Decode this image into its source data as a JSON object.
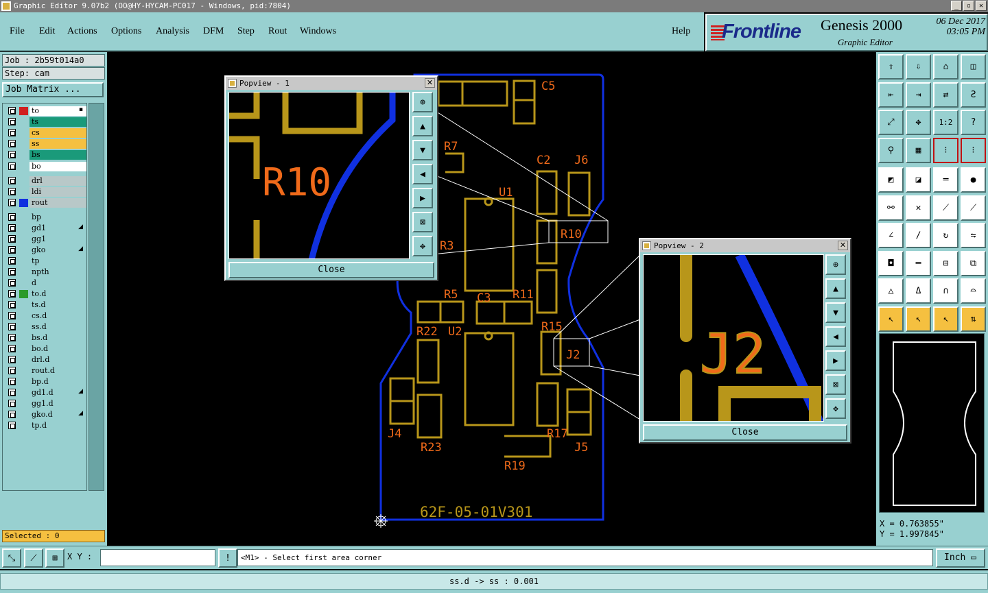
{
  "window": {
    "title": "Graphic Editor 9.07b2 (OO@HY-HYCAM-PC017 - Windows, pid:7804)",
    "min": "_",
    "max": "▫",
    "close": "✕"
  },
  "menu": {
    "file": "File",
    "edit": "Edit",
    "actions": "Actions",
    "options": "Options",
    "analysis": "Analysis",
    "dfm": "DFM",
    "step": "Step",
    "rout": "Rout",
    "windows": "Windows",
    "help": "Help"
  },
  "brand": {
    "logo": "Frontline",
    "product": "Genesis 2000",
    "subtitle": "Graphic Editor",
    "date": "06 Dec 2017",
    "time": "03:05 PM"
  },
  "job": {
    "job_line": "Job : 2b59t014a0",
    "step_line": "Step: cam",
    "matrix_button": "Job Matrix ..."
  },
  "layers": [
    {
      "name": "to",
      "bg": "#ffffff",
      "swatch": "#d02020",
      "mark": "▪"
    },
    {
      "name": "ts",
      "bg": "#1a9a7a",
      "swatch": "",
      "mark": ""
    },
    {
      "name": "cs",
      "bg": "#f5c040",
      "swatch": "",
      "mark": ""
    },
    {
      "name": "ss",
      "bg": "#f5c040",
      "swatch": "",
      "mark": ""
    },
    {
      "name": "bs",
      "bg": "#1a9a7a",
      "swatch": "",
      "mark": ""
    },
    {
      "name": "bo",
      "bg": "#ffffff",
      "swatch": "",
      "mark": ""
    },
    {
      "name": "drl",
      "bg": "#b8c8c8",
      "swatch": "",
      "mark": ""
    },
    {
      "name": "ldi",
      "bg": "#b8c8c8",
      "swatch": "",
      "mark": ""
    },
    {
      "name": "rout",
      "bg": "#b8c8c8",
      "swatch": "#1030e0",
      "mark": ""
    },
    {
      "name": "bp",
      "bg": "#98d0d0",
      "swatch": "",
      "mark": ""
    },
    {
      "name": "gd1",
      "bg": "#98d0d0",
      "swatch": "",
      "mark": "◢"
    },
    {
      "name": "gg1",
      "bg": "#98d0d0",
      "swatch": "",
      "mark": ""
    },
    {
      "name": "gko",
      "bg": "#98d0d0",
      "swatch": "",
      "mark": "◢"
    },
    {
      "name": "tp",
      "bg": "#98d0d0",
      "swatch": "",
      "mark": ""
    },
    {
      "name": "npth",
      "bg": "#98d0d0",
      "swatch": "",
      "mark": ""
    },
    {
      "name": "d",
      "bg": "#98d0d0",
      "swatch": "",
      "mark": ""
    },
    {
      "name": "to.d",
      "bg": "#98d0d0",
      "swatch": "#2a9a2a",
      "mark": ""
    },
    {
      "name": "ts.d",
      "bg": "#98d0d0",
      "swatch": "",
      "mark": ""
    },
    {
      "name": "cs.d",
      "bg": "#98d0d0",
      "swatch": "",
      "mark": ""
    },
    {
      "name": "ss.d",
      "bg": "#98d0d0",
      "swatch": "",
      "mark": ""
    },
    {
      "name": "bs.d",
      "bg": "#98d0d0",
      "swatch": "",
      "mark": ""
    },
    {
      "name": "bo.d",
      "bg": "#98d0d0",
      "swatch": "",
      "mark": ""
    },
    {
      "name": "drl.d",
      "bg": "#98d0d0",
      "swatch": "",
      "mark": ""
    },
    {
      "name": "rout.d",
      "bg": "#98d0d0",
      "swatch": "",
      "mark": ""
    },
    {
      "name": "bp.d",
      "bg": "#98d0d0",
      "swatch": "",
      "mark": ""
    },
    {
      "name": "gd1.d",
      "bg": "#98d0d0",
      "swatch": "",
      "mark": "◢"
    },
    {
      "name": "gg1.d",
      "bg": "#98d0d0",
      "swatch": "",
      "mark": ""
    },
    {
      "name": "gko.d",
      "bg": "#98d0d0",
      "swatch": "",
      "mark": "◢"
    },
    {
      "name": "tp.d",
      "bg": "#98d0d0",
      "swatch": "",
      "mark": ""
    }
  ],
  "selected": "Selected : 0",
  "board": {
    "labels": [
      "C5",
      "R7",
      "C2",
      "J6",
      "U1",
      "R10",
      "R3",
      "R5",
      "C3",
      "R11",
      "R15",
      "R22",
      "U2",
      "J2",
      "J4",
      "R23",
      "R17",
      "J5",
      "R19"
    ],
    "board_text": "62F-05-01V301",
    "colors": {
      "pad": "#b8961a",
      "text": "#f06a1a",
      "outline": "#1030e0"
    }
  },
  "popview1": {
    "title": "Popview - 1",
    "label": "R10",
    "close": "Close"
  },
  "popview2": {
    "title": "Popview - 2",
    "label": "J2",
    "close": "Close"
  },
  "coords": {
    "x": "X = 0.763855\"",
    "y": "Y = 1.997845\""
  },
  "bottom": {
    "xy_label": "X Y :",
    "xy_value": "",
    "bang": "!",
    "prompt": "<M1> - Select first area corner",
    "unit": "Inch",
    "status": "ss.d -> ss : 0.001"
  },
  "toolbar_icons": [
    "open-job-icon",
    "save-icon",
    "home-icon",
    "layout-icon",
    "pan-left-icon",
    "pan-right-icon",
    "zoom-swap-icon",
    "zigzag-icon",
    "fit-all-icon",
    "zoom-fit-icon",
    "scale-1-2-icon",
    "help-icon",
    "measure-tool-icon",
    "grid-icon",
    "snap-red-icon",
    "snap-red2-icon",
    "feature-info-icon",
    "color-icon",
    "ruler-icon",
    "dot-select-icon",
    "connect-icon",
    "cross-icon",
    "line-red-icon",
    "line-blue-icon",
    "angle-icon",
    "slash-icon",
    "rotate-icon",
    "mirror-icon",
    "pad-icon",
    "minus-icon",
    "frame-icon",
    "group-icon",
    "triangle-icon",
    "triangle-a-icon",
    "arch-icon",
    "arch-cut-icon",
    "pointer-icon",
    "pointer-box-icon",
    "pointer-flag-icon",
    "flow-icon"
  ]
}
